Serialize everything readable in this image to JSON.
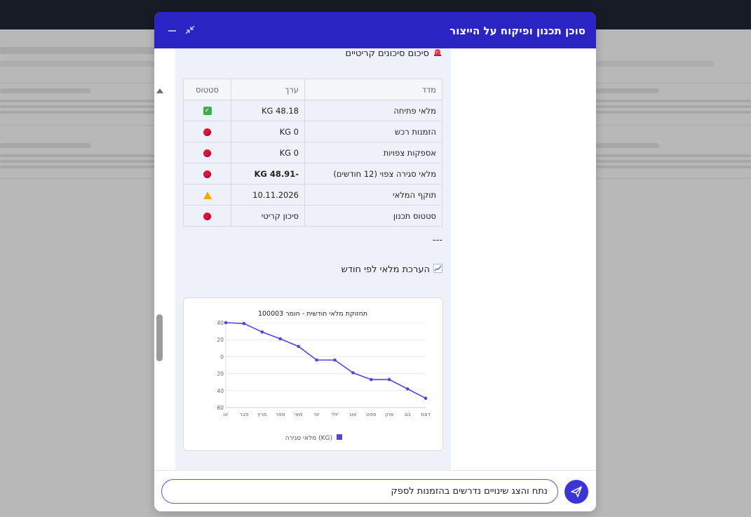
{
  "header": {
    "title": "סוכן תכנון ופיקוח על הייצור"
  },
  "sections": {
    "risk_title": "סיכום סיכונים קריטיים",
    "risk_icon": "alarm-light-icon",
    "divider": "---",
    "chart_title": "הערכת מלאי לפי חודש",
    "chart_icon": "chart-increasing-icon"
  },
  "table": {
    "headers": {
      "metric": "מדד",
      "value": "ערך",
      "status": "סטטוס"
    },
    "rows": [
      {
        "metric": "מלאי פתיחה",
        "value": "KG 48.18",
        "status": "check"
      },
      {
        "metric": "הזמנות רכש",
        "value": "KG 0",
        "status": "red"
      },
      {
        "metric": "אספקות צפויות",
        "value": "KG 0",
        "status": "red"
      },
      {
        "metric": "מלאי סגירה צפוי (12 חודשים)",
        "value": "-KG 48.91",
        "status": "red",
        "bold": true
      },
      {
        "metric": "תוקף המלאי",
        "value": "10.11.2026",
        "status": "warning"
      },
      {
        "metric": "סטטוס תכנון",
        "value": "סיכון קריטי",
        "status": "red"
      }
    ]
  },
  "chart_data": {
    "type": "line",
    "title": "תחזוקת מלאי חודשית - חומר 100003",
    "categories": [
      "ינו",
      "פבר",
      "מרץ",
      "אפר",
      "מאי",
      "יוני",
      "יולי",
      "אוג",
      "ספט",
      "אוק",
      "נוב",
      "דצמ"
    ],
    "y_tick_labels": [
      "40",
      "20",
      "0",
      "20",
      "40",
      "60"
    ],
    "ylim": [
      -60,
      40
    ],
    "series": [
      {
        "name": "מלאי סגירה (KG)",
        "color": "#4f46e5",
        "values": [
          40,
          39,
          29,
          21,
          12,
          -4,
          -4,
          -19,
          -27,
          -27,
          -38,
          -49
        ]
      }
    ],
    "legend_position": "bottom",
    "grid": true
  },
  "input": {
    "value": "נתח והצג שינויים נדרשים בהזמנות לספק",
    "placeholder": ""
  },
  "colors": {
    "header": "#2a24c4",
    "accent": "#3b35d6",
    "line": "#4f46e5"
  }
}
